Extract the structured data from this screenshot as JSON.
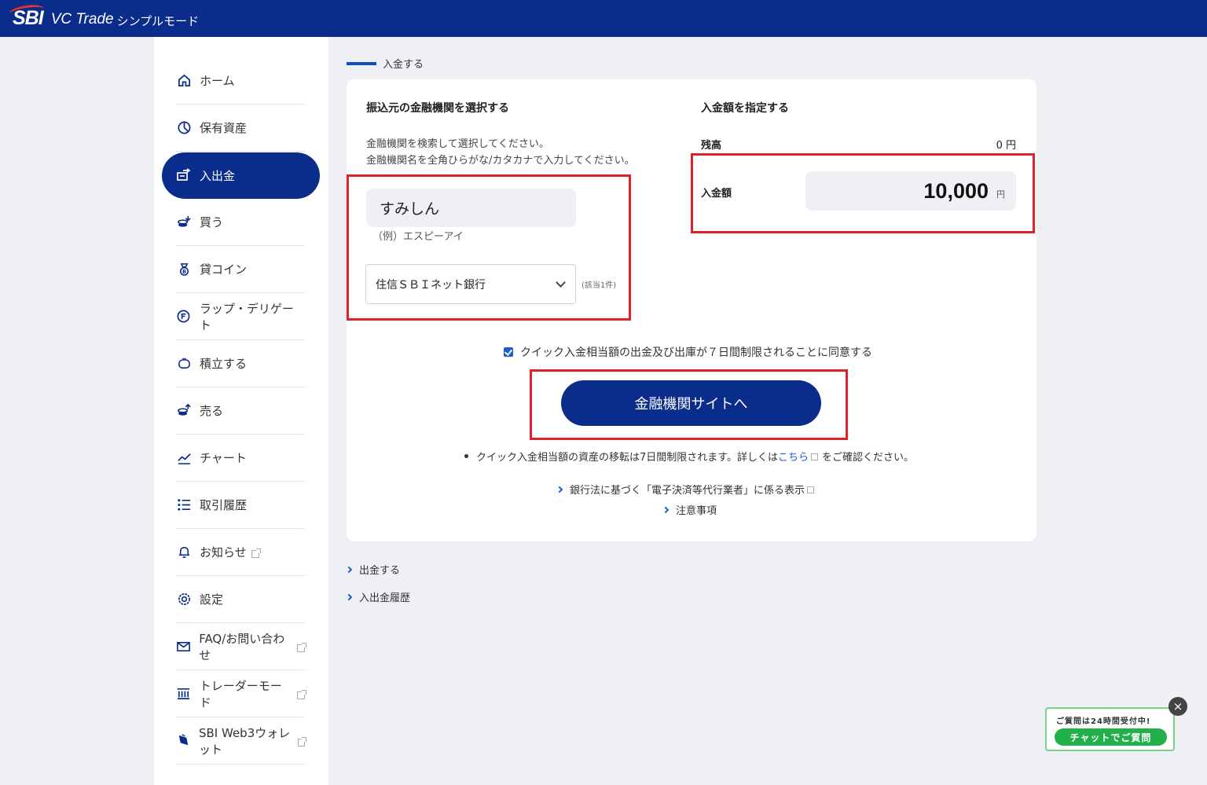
{
  "header": {
    "logo": "SBI",
    "app_name": "VC Trade",
    "mode": "シンプルモード"
  },
  "sidebar": {
    "items": [
      {
        "label": "ホーム",
        "icon": "home-icon"
      },
      {
        "label": "保有資産",
        "icon": "pie-chart-icon"
      },
      {
        "label": "入出金",
        "icon": "transfer-icon",
        "active": true
      },
      {
        "label": "買う",
        "icon": "buy-coins-icon"
      },
      {
        "label": "貸コイン",
        "icon": "lend-coin-icon"
      },
      {
        "label": "ラップ・デリゲート",
        "icon": "wrap-icon"
      },
      {
        "label": "積立する",
        "icon": "piggy-bank-icon"
      },
      {
        "label": "売る",
        "icon": "sell-coins-icon"
      },
      {
        "label": "チャート",
        "icon": "chart-line-icon"
      },
      {
        "label": "取引履歴",
        "icon": "list-icon"
      },
      {
        "label": "お知らせ",
        "icon": "bell-icon",
        "external": true
      },
      {
        "label": "設定",
        "icon": "gear-icon"
      },
      {
        "label": "FAQ/お問い合わせ",
        "icon": "mail-icon",
        "external": true
      },
      {
        "label": "トレーダーモード",
        "icon": "bank-icon",
        "external": true
      },
      {
        "label": "SBI Web3ウォレット",
        "icon": "wallet-icon",
        "external": true
      }
    ]
  },
  "page": {
    "heading": "入金する"
  },
  "bank_select": {
    "title": "振込元の金融機関を選択する",
    "help_line1": "金融機関を検索して選択してください。",
    "help_line2": "金融機関名を全角ひらがな/カタカナで入力してください。",
    "search_value": "すみしん",
    "example": "（例）エスピーアイ",
    "selected_bank": "住信ＳＢＩネット銀行",
    "match_count": "(該当1件)"
  },
  "amount": {
    "title": "入金額を指定する",
    "balance_label": "残高",
    "balance_value": "0 円",
    "amount_label": "入金額",
    "amount_value": "10,000",
    "amount_unit": "円"
  },
  "agreement": {
    "checked": true,
    "text": "クイック入金相当額の出金及び出庫が７日間制限されることに同意する"
  },
  "cta": {
    "label": "金融機関サイトへ"
  },
  "notes": {
    "text_before": "クイック入金相当額の資産の移転は7日間制限されます。詳しくは",
    "link": "こちら",
    "text_after": "をご確認ください。"
  },
  "links": {
    "banking_law": "銀行法に基づく「電子決済等代行業者」に係る表示",
    "notice": "注意事項",
    "withdraw": "出金する",
    "history": "入出金履歴"
  },
  "chat": {
    "title": "ご質問は24時間受付中!",
    "button": "チャットでご質問",
    "close": "×"
  },
  "colors": {
    "brand": "#0a2d8c",
    "highlight_frame": "#e0202a",
    "chat_green": "#22b04a"
  }
}
